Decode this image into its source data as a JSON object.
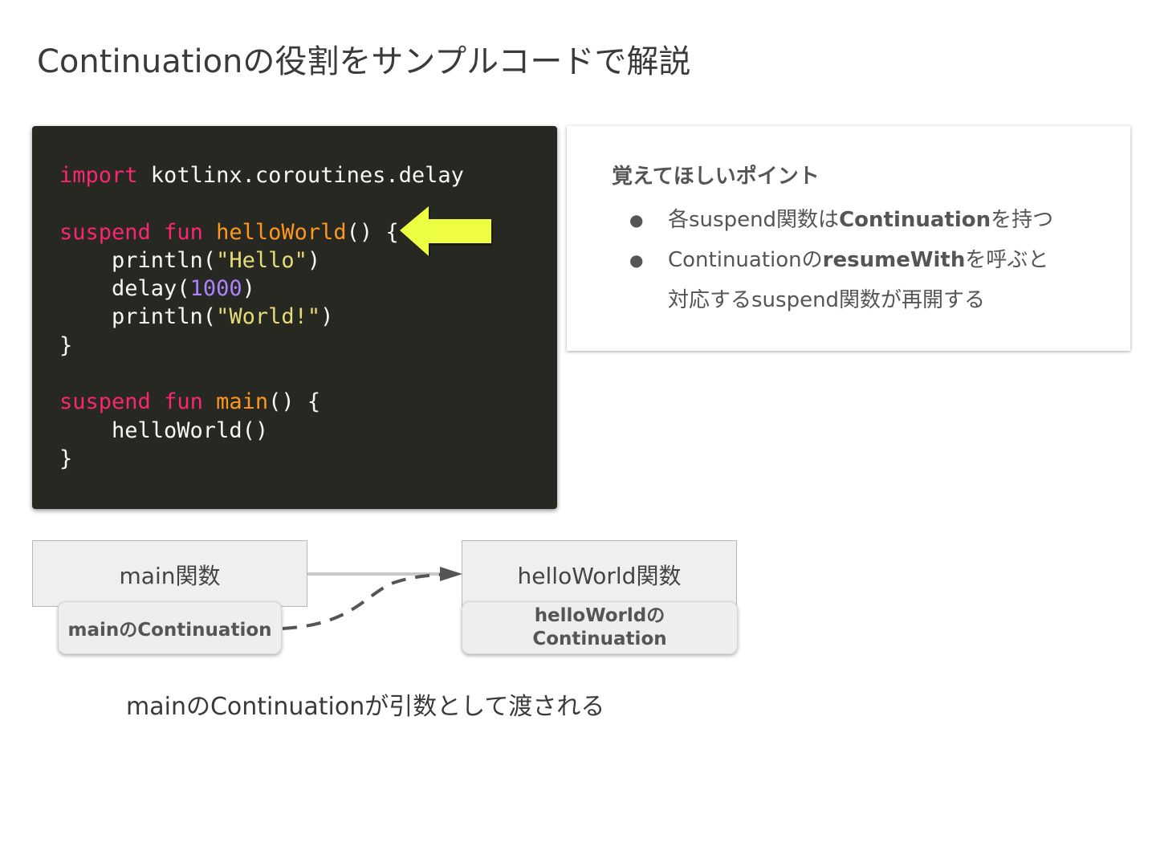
{
  "slide": {
    "title": "Continuationの役割をサンプルコードで解説"
  },
  "code_lines": [
    [
      {
        "t": "kw",
        "s": "import"
      },
      {
        "t": "plain",
        "s": " kotlinx.coroutines.delay"
      }
    ],
    [],
    [
      {
        "t": "kw",
        "s": "suspend"
      },
      {
        "t": "plain",
        "s": " "
      },
      {
        "t": "kw",
        "s": "fun"
      },
      {
        "t": "plain",
        "s": " "
      },
      {
        "t": "fn",
        "s": "helloWorld"
      },
      {
        "t": "plain",
        "s": "() {"
      }
    ],
    [
      {
        "t": "plain",
        "s": "    println("
      },
      {
        "t": "str",
        "s": "\"Hello\""
      },
      {
        "t": "plain",
        "s": ")"
      }
    ],
    [
      {
        "t": "plain",
        "s": "    delay("
      },
      {
        "t": "num",
        "s": "1000"
      },
      {
        "t": "plain",
        "s": ")"
      }
    ],
    [
      {
        "t": "plain",
        "s": "    println("
      },
      {
        "t": "str",
        "s": "\"World!\""
      },
      {
        "t": "plain",
        "s": ")"
      }
    ],
    [
      {
        "t": "plain",
        "s": "}"
      }
    ],
    [],
    [
      {
        "t": "kw",
        "s": "suspend"
      },
      {
        "t": "plain",
        "s": " "
      },
      {
        "t": "kw",
        "s": "fun"
      },
      {
        "t": "plain",
        "s": " "
      },
      {
        "t": "fn",
        "s": "main"
      },
      {
        "t": "plain",
        "s": "() {"
      }
    ],
    [
      {
        "t": "plain",
        "s": "    helloWorld()"
      }
    ],
    [
      {
        "t": "plain",
        "s": "}"
      }
    ]
  ],
  "points": {
    "heading": "覚えてほしいポイント",
    "bullet_char": "●",
    "items": [
      {
        "parts": [
          {
            "text": "各suspend関数は",
            "bold": false
          },
          {
            "text": "Continuation",
            "bold": true
          },
          {
            "text": "を持つ",
            "bold": false
          }
        ]
      },
      {
        "parts": [
          {
            "text": "Continuationの",
            "bold": false
          },
          {
            "text": "resumeWith",
            "bold": true
          },
          {
            "text": "を呼ぶと",
            "bold": false
          }
        ]
      }
    ],
    "continuation_line": "対応するsuspend関数が再開する"
  },
  "diagram": {
    "main_box_label": "main関数",
    "hello_box_label": "helloWorld関数",
    "main_cont_label": "mainのContinuation",
    "hello_cont_line1": "helloWorldの",
    "hello_cont_line2": "Continuation",
    "caption": "mainのContinuationが引数として渡される"
  },
  "colors": {
    "code_bg": "#272822",
    "keyword": "#f92672",
    "function": "#fd971f",
    "string": "#e6db74",
    "number": "#ae81ff",
    "highlight_arrow": "#eeff41"
  }
}
